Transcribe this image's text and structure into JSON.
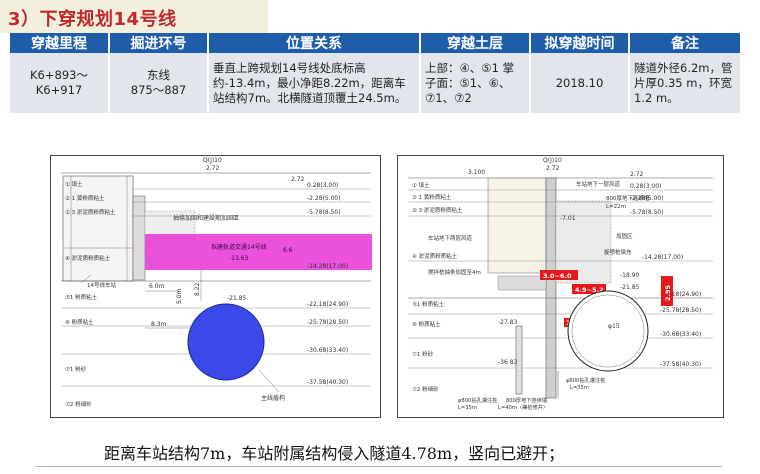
{
  "section_title": "3）下穿规划14号线",
  "table": {
    "headers": [
      "穿越里程",
      "掘进环号",
      "位置关系",
      "穿越土层",
      "拟穿越时间",
      "备注"
    ],
    "row": {
      "mileage": [
        "K6+893～",
        "K6+917"
      ],
      "ring": [
        "东线",
        "875～887"
      ],
      "relation": "垂直上跨规划14号线处底标高约-13.4m，最小净距8.22m，距离车站结构7m。北横隧道顶覆土24.5m。",
      "layers": "上部：④、⑤1 掌子面：⑤1、⑥、⑦1、⑦2",
      "time": "2018.10",
      "remark": "隧道外径6.2m，管片厚0.35 m，环宽1.2 m。"
    }
  },
  "caption": "距离车站结构7m，车站附属结构侵入隧道4.78m，竖向已避开；",
  "left_diagram": {
    "top_label": "Q(J)10",
    "top_value": "2.72",
    "levels": [
      "2.72",
      "0.28(3.00)",
      "-2.28(5.00)",
      "-5.78(8.50)",
      "-14.28(17.00)",
      "-22.18(24.90)",
      "-25.78(28.50)",
      "-30.68(33.40)",
      "-37.58(40.30)"
    ],
    "layer_labels": [
      "① 填土",
      "② 1 黄粉质粘土",
      "② 3 淤泥质粉质粘土",
      "④ 淤泥质粉质粘土",
      "⑤1 粉质粘土",
      "⑥ 粉质粘土",
      "⑦1 粉砂",
      "⑦2 粉细砂"
    ],
    "annotations": {
      "reinforce": "抽條加固和建設期加固區",
      "line14": "拟建轨道交通14号线",
      "line14_value": "-13.63",
      "line14_tag": "14号线车站",
      "dim_6": "6.0m",
      "dim_5": "5.0m",
      "dim_822": "8.22",
      "dim_83": "8.3m",
      "tunnel_top": "-21.85",
      "tunnel_label": "主线盾构",
      "dim_h": "6.6"
    }
  },
  "right_diagram": {
    "top_label": "Q(J)10",
    "top_value": "2.72",
    "levels": [
      "3.100",
      "2.72",
      "0.28(3.00)",
      "-2.28(5.00)",
      "-5.78(8.50)",
      "-14.28(17.00)",
      "-22.18(24.90)",
      "-25.78(28.50)",
      "-30.68(33.40)",
      "-37.58(40.30)"
    ],
    "layer_labels": [
      "① 填土",
      "② 1 黄粉质粘土",
      "② 3 淤泥质粉质粘土",
      "车站地下两层风道",
      "④ 淤泥质粉质粘土",
      "搅拌桩抽条加固至4m",
      "⑤1 粉质粘土",
      "⑥ 粉质粘土",
      "⑦1 粉砂",
      "⑦2 粉细砂"
    ],
    "annotations": {
      "station_wind": "车站地下一层风道",
      "wall": "800厚地下连续墙",
      "wall_len": "L=22m",
      "depth1": "-7.01",
      "grout": "加固区",
      "jet": "旋喷桩填充",
      "depth2": "-18.90",
      "depth3": "-21.85",
      "red1": "3.0~6.0",
      "red2": "4.9~5.2",
      "red3": "7.5",
      "red_v": "2.95",
      "d15": "φ15",
      "d2783": "-27.83",
      "d3683": "-36.83",
      "pile1": "φ800钻孔灌注桩",
      "pile1_len": "L=35m",
      "pile2": "800厚地下连续墙",
      "pile2_len": "L=40m（兼检修井）",
      "pile3": "φ800钻孔灌注桩",
      "pile3_len": "L=35m"
    }
  }
}
